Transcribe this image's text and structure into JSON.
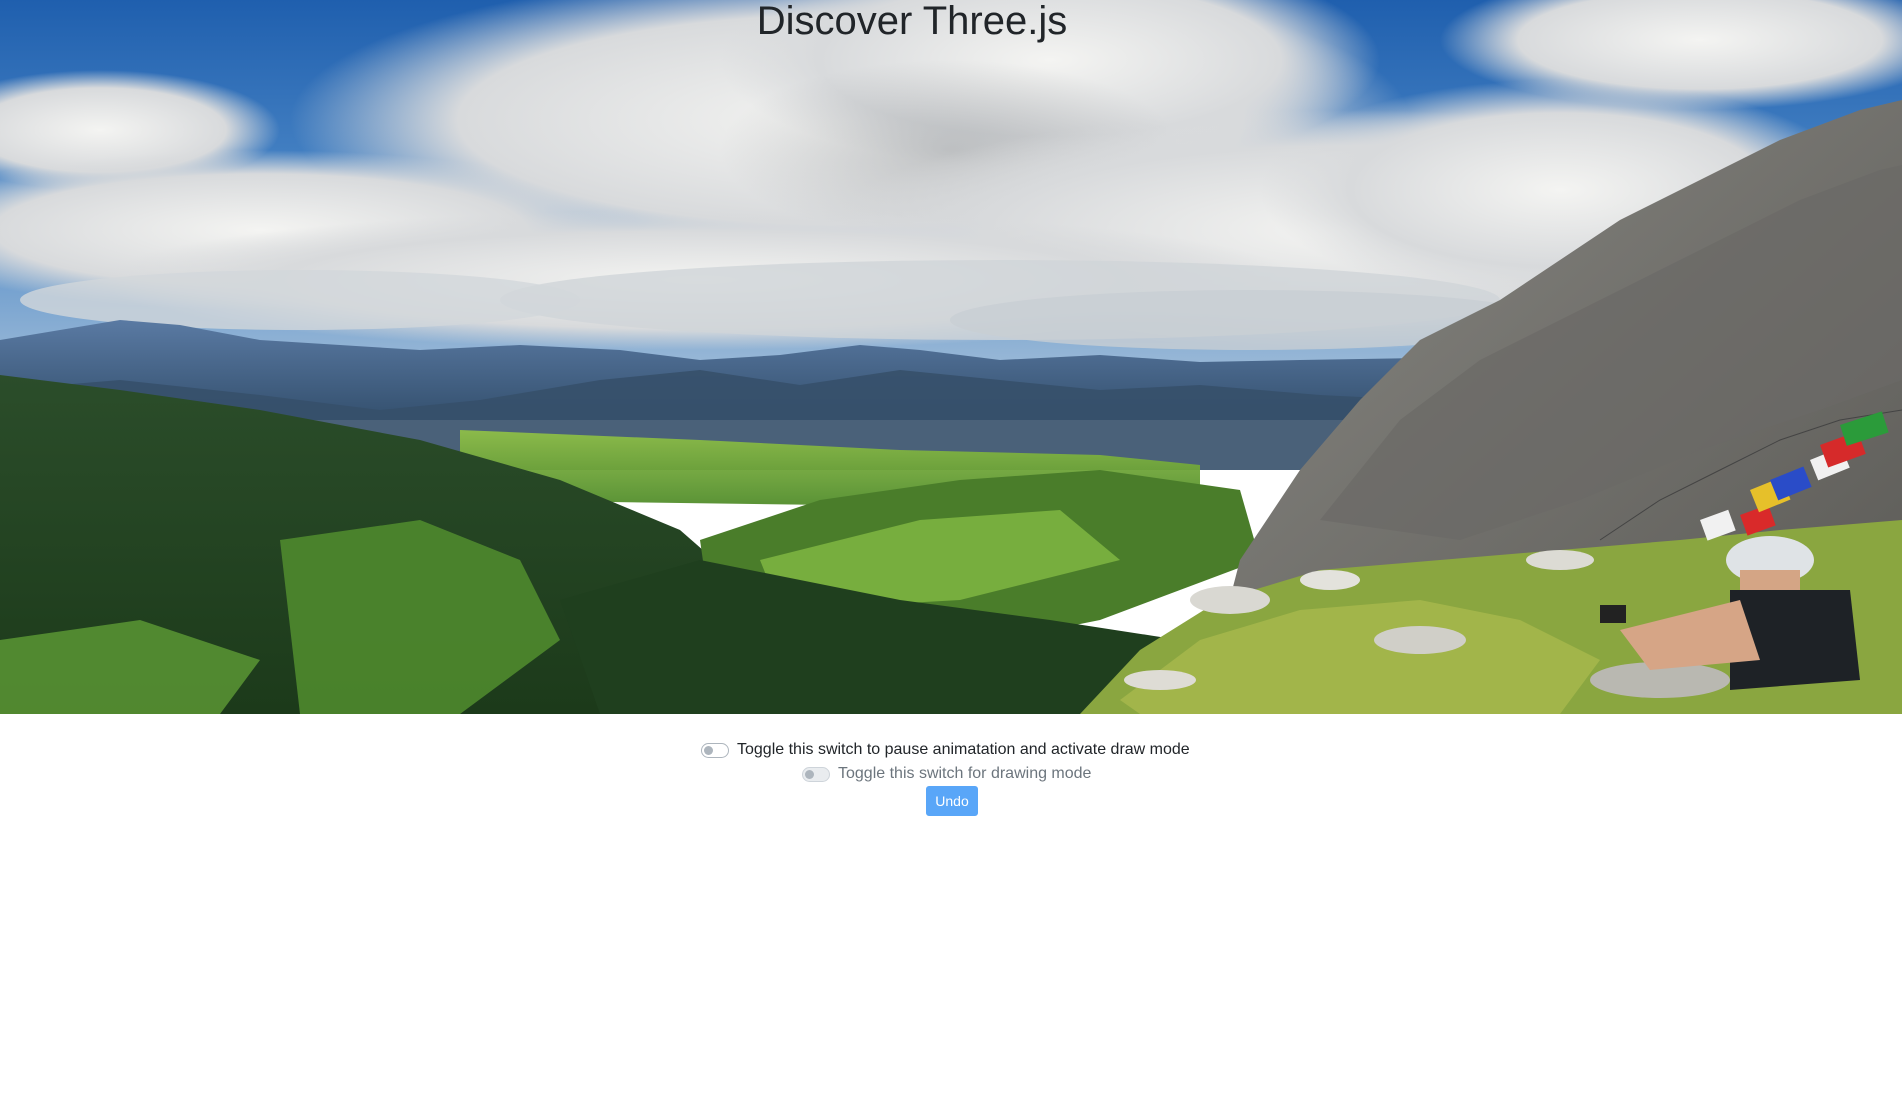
{
  "header": {
    "title": "Discover Three.js"
  },
  "scene": {
    "icon": "panorama-image",
    "colors": {
      "sky": "#2f6fb8",
      "cloud": "#e9ecef",
      "mountain_far": "#4a6a92",
      "hills": "#2f5a2a",
      "meadow": "#6ea83c",
      "rock": "#7c7b78"
    }
  },
  "controls": {
    "animation_switch": {
      "label": "Toggle this switch to pause animatation and activate draw mode",
      "checked": false
    },
    "drawing_switch": {
      "label": "Toggle this switch for drawing mode",
      "checked": false,
      "disabled": true
    },
    "undo_label": "Undo",
    "accent_color": "#59a6f8"
  }
}
